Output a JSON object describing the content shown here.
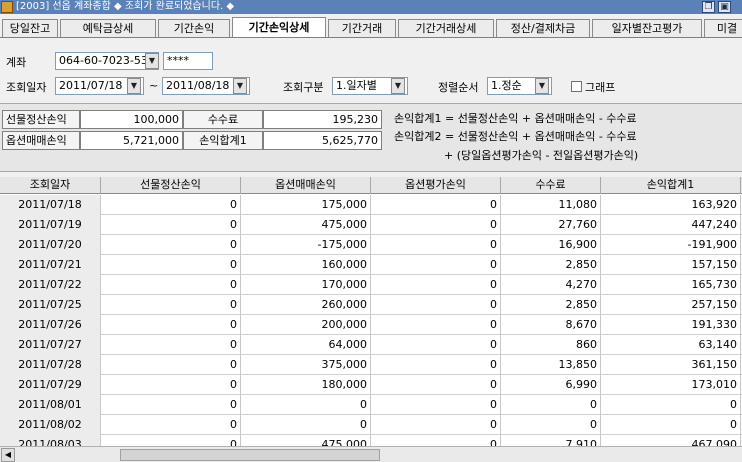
{
  "window": {
    "title": "[2003] 선옵 계좌종합   ◆ 조회가 완료되었습니다. ◆"
  },
  "tabs": [
    {
      "label": "당일잔고"
    },
    {
      "label": "예탁금상세"
    },
    {
      "label": "기간손익"
    },
    {
      "label": "기간손익상세",
      "active": true
    },
    {
      "label": "기간거래"
    },
    {
      "label": "기간거래상세"
    },
    {
      "label": "정산/결제차금"
    },
    {
      "label": "일자별잔고평가"
    },
    {
      "label": "미결"
    }
  ],
  "form": {
    "account_label": "계좌",
    "account_value": "064-60-7023-53",
    "password_value": "****",
    "date_label": "조회일자",
    "date_from": "2011/07/18",
    "date_sep": "~",
    "date_to": "2011/08/18",
    "query_type_label": "조회구분",
    "query_type_value": "1.일자별",
    "sort_label": "정렬순서",
    "sort_value": "1.정순",
    "graph_label": "그래프",
    "graph_checked": false
  },
  "summary": {
    "futures_label": "선물정산손익",
    "futures_value": "100,000",
    "fee_label": "수수료",
    "fee_value": "195,230",
    "options_label": "옵션매매손익",
    "options_value": "5,721,000",
    "total1_label": "손익합계1",
    "total1_value": "5,625,770",
    "formula1": "손익합계1 = 선물정산손익 + 옵션매매손익 - 수수료",
    "formula2": "손익합계2 = 선물정산손익 + 옵션매매손익 - 수수료",
    "formula3": "+ (당일옵션평가손익 - 전일옵션평가손익)"
  },
  "table": {
    "headers": [
      "조회일자",
      "선물정산손익",
      "옵션매매손익",
      "옵션평가손익",
      "수수료",
      "손익합계1"
    ],
    "rows": [
      [
        "2011/07/18",
        "0",
        "175,000",
        "0",
        "11,080",
        "163,920"
      ],
      [
        "2011/07/19",
        "0",
        "475,000",
        "0",
        "27,760",
        "447,240"
      ],
      [
        "2011/07/20",
        "0",
        "-175,000",
        "0",
        "16,900",
        "-191,900"
      ],
      [
        "2011/07/21",
        "0",
        "160,000",
        "0",
        "2,850",
        "157,150"
      ],
      [
        "2011/07/22",
        "0",
        "170,000",
        "0",
        "4,270",
        "165,730"
      ],
      [
        "2011/07/25",
        "0",
        "260,000",
        "0",
        "2,850",
        "257,150"
      ],
      [
        "2011/07/26",
        "0",
        "200,000",
        "0",
        "8,670",
        "191,330"
      ],
      [
        "2011/07/27",
        "0",
        "64,000",
        "0",
        "860",
        "63,140"
      ],
      [
        "2011/07/28",
        "0",
        "375,000",
        "0",
        "13,850",
        "361,150"
      ],
      [
        "2011/07/29",
        "0",
        "180,000",
        "0",
        "6,990",
        "173,010"
      ],
      [
        "2011/08/01",
        "0",
        "0",
        "0",
        "0",
        "0"
      ],
      [
        "2011/08/02",
        "0",
        "0",
        "0",
        "0",
        "0"
      ],
      [
        "2011/08/03",
        "0",
        "475,000",
        "0",
        "7,910",
        "467,090"
      ]
    ]
  },
  "colors": {
    "titlebar": "#5a82b8",
    "active_tab": "#ffffff",
    "panel": "#e6e6e6"
  }
}
